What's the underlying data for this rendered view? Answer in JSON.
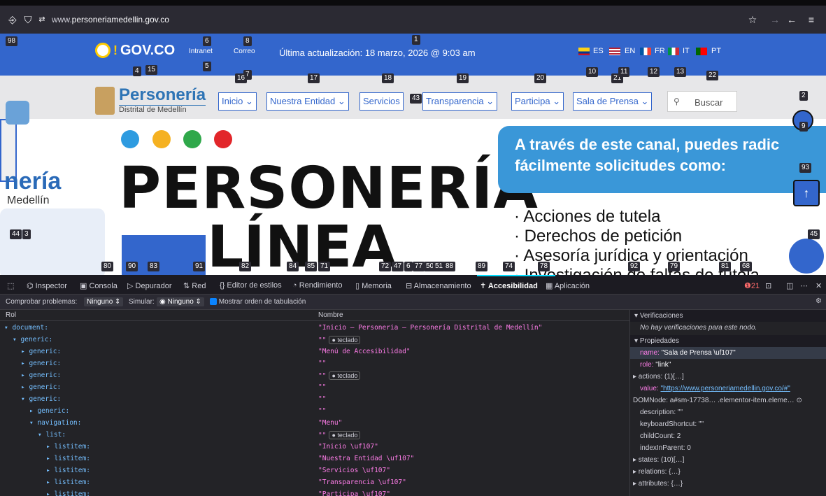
{
  "browser": {
    "url_prefix": "www.",
    "url_domain": "personeriamedellin.gov.co"
  },
  "govbar": {
    "logo": "GOV.CO",
    "update": "Última actualización: 18 marzo, 2026 @ 9:03 am",
    "link1": "Intranet",
    "link2": "Correo",
    "languages": [
      "ES",
      "EN",
      "FR",
      "IT",
      "PT"
    ]
  },
  "site_header": {
    "logo_title": "Personería",
    "logo_sub": "Distrital de Medellín",
    "nav": [
      "Inicio",
      "Nuestra Entidad",
      "Servicios",
      "Transparencia",
      "Participa",
      "Sala de Prensa"
    ],
    "search_placeholder": "Buscar"
  },
  "hero": {
    "title": "PERSONERÍA",
    "subtitle": "LÍNEA",
    "left_title": "nería",
    "left_sub": "Medellín",
    "panel_line1": "A través de este canal, puedes radic",
    "panel_line2": "fácilmente solicitudes como:",
    "bullets": [
      "· Acciones de tutela",
      "· Derechos de petición",
      "· Asesoría jurídica y orientación",
      "· Investigación de faltas de tutela"
    ],
    "dot_colors": [
      "#2e9be0",
      "#f5b121",
      "#2fa84a",
      "#e2262a"
    ]
  },
  "tags": [
    "98",
    "1",
    "6",
    "8",
    "5",
    "7",
    "4",
    "15",
    "16",
    "17",
    "18",
    "19",
    "20",
    "21",
    "22",
    "10",
    "11",
    "12",
    "13",
    "2",
    "9",
    "93",
    "43",
    "44",
    "3",
    "45",
    "80",
    "90",
    "83",
    "91",
    "82",
    "84",
    "85",
    "71",
    "72",
    "47",
    "6",
    "77",
    "50",
    "51",
    "88",
    "89",
    "74",
    "78",
    "92",
    "79",
    "81",
    "68"
  ],
  "devtools": {
    "tabs": [
      "Inspector",
      "Consola",
      "Depurador",
      "Red",
      "Editor de estilos",
      "Rendimiento",
      "Memoria",
      "Almacenamiento",
      "Accesibilidad",
      "Aplicación"
    ],
    "error_count": "21",
    "toolbar": {
      "check_label": "Comprobar problemas:",
      "check_value": "Ninguno",
      "simulate_label": "Simular:",
      "simulate_value": "Ninguno",
      "tab_order": "Mostrar orden de tabulación"
    },
    "col_role": "Rol",
    "col_name": "Nombre",
    "tree": [
      {
        "role": "▾ document:",
        "name": "\"Inicio – Personeria – Personería Distrital de Medellín\"",
        "indent": 0
      },
      {
        "role": "▾ generic:",
        "name": "\"\"",
        "badge": "teclado",
        "indent": 1
      },
      {
        "role": "▸ generic:",
        "name": "\"Menú de Accesibilidad\"",
        "indent": 2
      },
      {
        "role": "▸ generic:",
        "name": "\"\"",
        "indent": 2
      },
      {
        "role": "▸ generic:",
        "name": "\"\"",
        "badge": "teclado",
        "indent": 2
      },
      {
        "role": "▸ generic:",
        "name": "\"\"",
        "indent": 2
      },
      {
        "role": "▾ generic:",
        "name": "\"\"",
        "indent": 2
      },
      {
        "role": "▸ generic:",
        "name": "\"\"",
        "indent": 3
      },
      {
        "role": "▾ navigation:",
        "name": "\"Menu\"",
        "indent": 3
      },
      {
        "role": "▾ list:",
        "name": "\"\"",
        "badge": "teclado",
        "indent": 4
      },
      {
        "role": "▸ listitem:",
        "name": "\"Inicio \\uf107\"",
        "indent": 5
      },
      {
        "role": "▸ listitem:",
        "name": "\"Nuestra Entidad \\uf107\"",
        "indent": 5
      },
      {
        "role": "▸ listitem:",
        "name": "\"Servicios \\uf107\"",
        "indent": 5
      },
      {
        "role": "▸ listitem:",
        "name": "\"Transparencia \\uf107\"",
        "indent": 5
      },
      {
        "role": "▸ listitem:",
        "name": "\"Participa \\uf107\"",
        "indent": 5
      }
    ],
    "side": {
      "verif_header": "Verificaciones",
      "verif_empty": "No hay verificaciones para este nodo.",
      "props_header": "Propiedades",
      "name_k": "name:",
      "name_v": "\"Sala de Prensa \\uf107\"",
      "role_k": "role:",
      "role_v": "\"link\"",
      "actions": "▸ actions: (1)[…]",
      "value_k": "value:",
      "value_v": "\"https://www.personeriamedellin.gov.co/#\"",
      "domnode": "DOMNode: a#sm-17738… .elementor-item.eleme…",
      "description": "description: \"\"",
      "kbd": "keyboardShortcut: \"\"",
      "childcount": "childCount: 2",
      "index": "indexInParent: 0",
      "states": "▸ states: (10)[…]",
      "relations": "▸ relations: {…}",
      "attributes": "▸ attributes: {…}"
    }
  }
}
